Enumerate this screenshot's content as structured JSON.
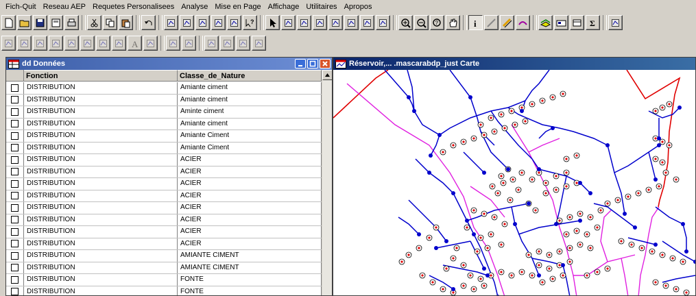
{
  "menu": [
    "Fich-Quit",
    "Reseau AEP",
    "Requetes Personalisees",
    "Analyse",
    "Mise en Page",
    "Affichage",
    "Utilitaires",
    "Apropos"
  ],
  "table_window": {
    "title": "dd Données",
    "columns": [
      "Fonction",
      "Classe_de_Nature"
    ],
    "rows": [
      [
        "DISTRIBUTION",
        "Amiante ciment"
      ],
      [
        "DISTRIBUTION",
        "Amiante ciment"
      ],
      [
        "DISTRIBUTION",
        "Aminte ciment"
      ],
      [
        "DISTRIBUTION",
        "Amiante ciment"
      ],
      [
        "DISTRIBUTION",
        "Amiante Ciment"
      ],
      [
        "DISTRIBUTION",
        "Amiante Ciment"
      ],
      [
        "DISTRIBUTION",
        "ACIER"
      ],
      [
        "DISTRIBUTION",
        "ACIER"
      ],
      [
        "DISTRIBUTION",
        "ACIER"
      ],
      [
        "DISTRIBUTION",
        "ACIER"
      ],
      [
        "DISTRIBUTION",
        "ACIER"
      ],
      [
        "DISTRIBUTION",
        "ACIER"
      ],
      [
        "DISTRIBUTION",
        "ACIER"
      ],
      [
        "DISTRIBUTION",
        "ACIER"
      ],
      [
        "DISTRIBUTION",
        "AMIANTE CIMENT"
      ],
      [
        "DISTRIBUTION",
        "AMIANTE CIMENT"
      ],
      [
        "DISTRIBUTION",
        "FONTE"
      ],
      [
        "DISTRIBUTION",
        "FONTE"
      ]
    ]
  },
  "map_window": {
    "title": "Réservoir,... .mascarabdp_just Carte"
  },
  "toolbar1_icons": [
    "new-document-icon",
    "open-folder-icon",
    "save-icon",
    "print-preview-icon",
    "print-icon",
    "cut-icon",
    "copy-icon",
    "paste-icon",
    "undo-icon",
    "new-browser-icon",
    "new-map-icon",
    "new-graph-icon",
    "new-layout-icon",
    "new-redistrict-icon",
    "help-cursor-icon",
    "select-arrow-icon",
    "marquee-select-icon",
    "radius-select-icon",
    "polygon-select-icon",
    "boundary-select-icon",
    "unselect-icon",
    "invert-select-icon",
    "graph-select-icon",
    "zoom-in-icon",
    "zoom-out-icon",
    "change-view-icon",
    "grabber-hand-icon",
    "info-icon",
    "ruler-icon",
    "drag-window-icon",
    "label-icon",
    "layer-control-icon",
    "legend-icon",
    "statistics-icon",
    "sum-icon",
    "overflow-icon"
  ],
  "toolbar2_icons": [
    "symbol-icon",
    "line-icon",
    "polyline-icon",
    "arc-icon",
    "polygon-icon",
    "ellipse-icon",
    "rectangle-icon",
    "rounded-rect-icon",
    "text-icon",
    "frame-icon",
    "add-node-icon",
    "reshape-icon",
    "custom-tool-1-icon",
    "custom-tool-2-icon",
    "custom-tool-3-icon",
    "custom-tool-4-icon"
  ],
  "colors": {
    "titlebar_active": "#0a246a",
    "pipe_blue": "#0000cc",
    "pipe_magenta": "#e020e0",
    "boundary_red": "#e00000",
    "marker_red": "#e00000"
  }
}
